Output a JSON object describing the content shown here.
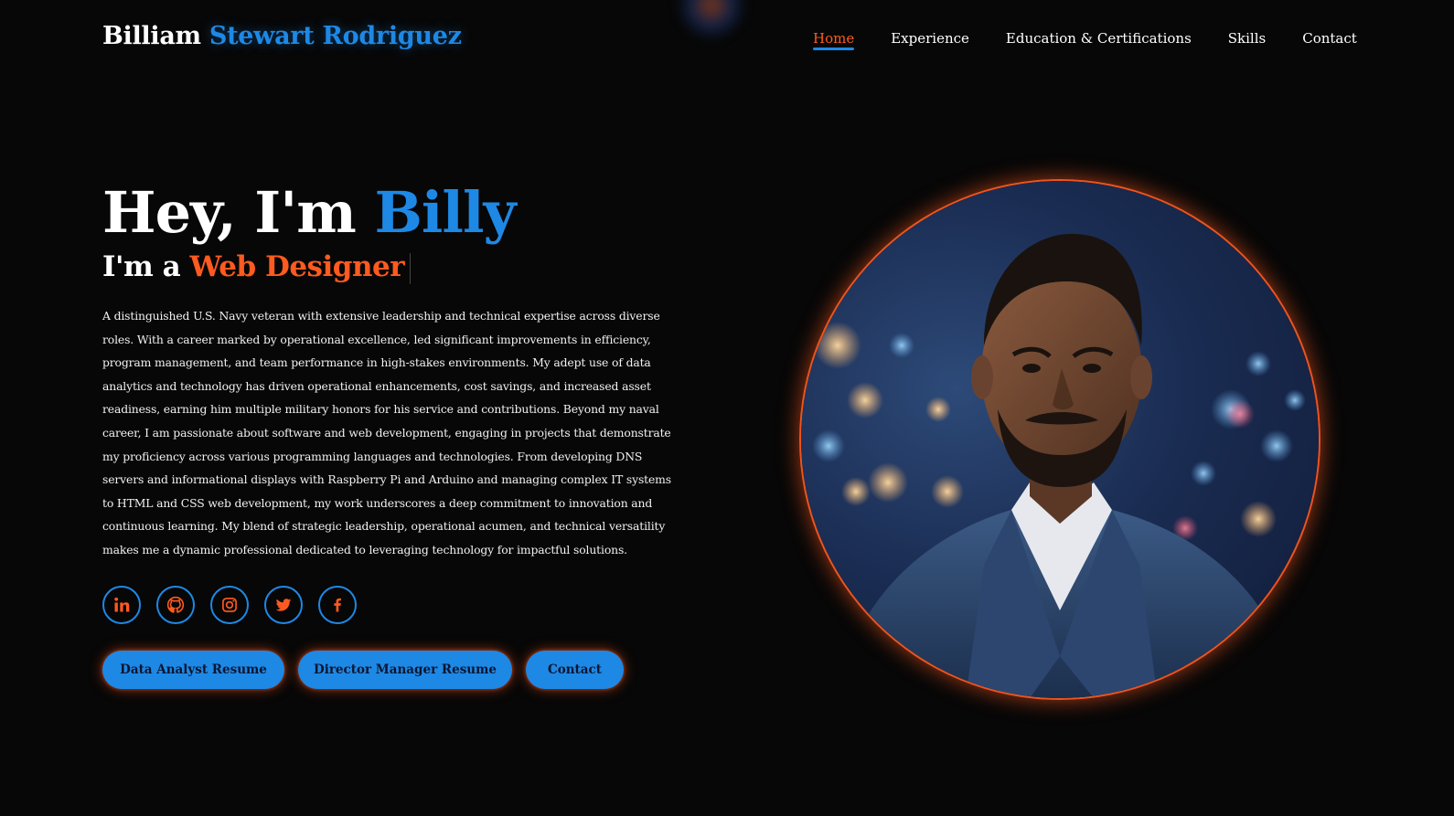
{
  "header": {
    "brand_first": "Billiam",
    "brand_rest": "Stewart Rodriguez",
    "nav": [
      {
        "label": "Home",
        "active": true
      },
      {
        "label": "Experience",
        "active": false
      },
      {
        "label": "Education & Certifications",
        "active": false
      },
      {
        "label": "Skills",
        "active": false
      },
      {
        "label": "Contact",
        "active": false
      }
    ]
  },
  "hero": {
    "greeting": "Hey, I'm",
    "name": "Billy",
    "role_prefix": "I'm a",
    "role": "Web Designer",
    "bio": "A distinguished U.S. Navy veteran with extensive leadership and technical expertise across diverse roles. With a career marked by operational excellence, led significant improvements in efficiency, program management, and team performance in high-stakes environments. My adept use of data analytics and technology has driven operational enhancements, cost savings, and increased asset readiness, earning him multiple military honors for his service and contributions. Beyond my naval career, I am passionate about software and web development, engaging in projects that demonstrate my proficiency across various programming languages and technologies. From developing DNS servers and informational displays with Raspberry Pi and Arduino and managing complex IT systems to HTML and CSS web development, my work underscores a deep commitment to innovation and continuous learning. My blend of strategic leadership, operational acumen, and technical versatility makes me a dynamic professional dedicated to leveraging technology for impactful solutions.",
    "socials": [
      "linkedin-icon",
      "github-icon",
      "instagram-icon",
      "twitter-icon",
      "facebook-icon"
    ],
    "buttons": {
      "data_analyst": "Data Analyst Resume",
      "director_manager": "Director Manager Resume",
      "contact": "Contact"
    }
  },
  "colors": {
    "background": "#070707",
    "accent_blue": "#1e88e5",
    "accent_orange": "#ff5a1f"
  }
}
